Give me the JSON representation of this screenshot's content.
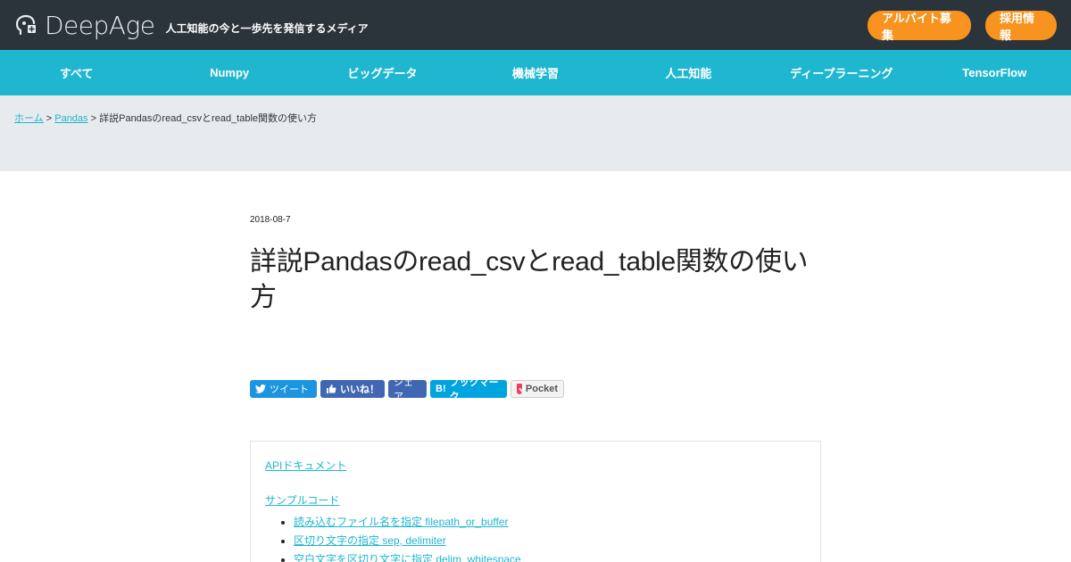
{
  "header": {
    "logo_text": "DeepAge",
    "tagline": "人工知能の今と一歩先を発信するメディア",
    "buttons": [
      "アルバイト募集",
      "採用情報"
    ],
    "brand_color": "#2b333b",
    "accent_color": "#f7931e"
  },
  "nav": {
    "color": "#1fb6cf",
    "items": [
      "すべて",
      "Numpy",
      "ビッグデータ",
      "機械学習",
      "人工知能",
      "ディープラーニング",
      "TensorFlow"
    ]
  },
  "breadcrumb": {
    "home": "ホーム",
    "sep": ">",
    "category": "Pandas",
    "current": "詳説Pandasのread_csvとread_table関数の使い方"
  },
  "article": {
    "date": "2018-08-7",
    "title": "詳説Pandasのread_csvとread_table関数の使い方"
  },
  "share": {
    "tweet": "ツイート",
    "like": "いいね！",
    "share": "シェア",
    "hatena": "ブックマーク",
    "hatena_mark": "B!",
    "pocket": "Pocket"
  },
  "toc": {
    "api_doc": "APIドキュメント",
    "sample_code": "サンプルコード",
    "items": [
      "読み込むファイル名を指定 filepath_or_buffer",
      "区切り文字の指定 sep, delimiter",
      "空白文字を区切り文字に指定 delim_whitespace"
    ]
  }
}
